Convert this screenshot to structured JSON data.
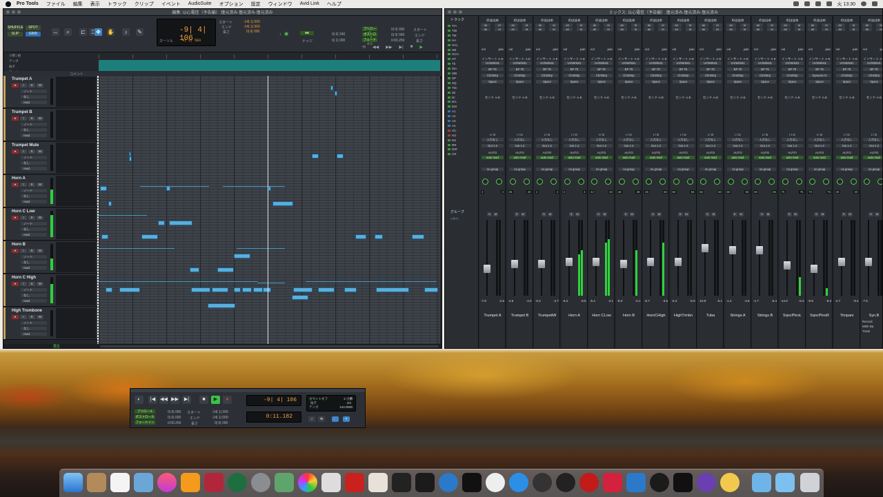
{
  "menubar": {
    "app": "Pro Tools",
    "items": [
      "ファイル",
      "編集",
      "表示",
      "トラック",
      "クリップ",
      "イベント",
      "AudioSuite",
      "オプション",
      "設定",
      "ウィンドウ",
      "Avid Link",
      "ヘルプ"
    ],
    "clock": "火 13:30"
  },
  "edit_window": {
    "title": "編集: 以心電信（予告編）.復元済み.復元済み.復元済み",
    "modes": [
      "SHUFFLE",
      "SPOT",
      "SLIP",
      "GRID"
    ],
    "counter": {
      "main": "-9| 4| 106",
      "label": "カーソル",
      "sub": "4| 3| 583",
      "start_label": "スタート",
      "end_label": "エンド",
      "length_label": "長さ",
      "start": "-14| 1| 000",
      "end": "-14| 1| 000",
      "length": "0| 0| 000"
    },
    "nudge": {
      "label": "ナッジ",
      "value": "0| 0| 240",
      "grid": "0| 1| 000"
    },
    "preroll": {
      "pre": "プリロール",
      "post": "ポストロール",
      "fade": "フェードイン",
      "pre_v": "0| 0| 000",
      "post_v": "0| 0| 000",
      "fade_v": "0:00.250"
    },
    "rulers": [
      "小節 | 拍",
      "テンポ",
      "拍子",
      "マーカー"
    ],
    "comment_label": "コメント",
    "tracks": [
      {
        "name": "Trumpet A",
        "meter": 0
      },
      {
        "name": "Trumpet B",
        "meter": 0
      },
      {
        "name": "Trumpet Mute",
        "meter": 0
      },
      {
        "name": "Horn A",
        "meter": 0.55
      },
      {
        "name": "Horn C Low",
        "meter": 0.85
      },
      {
        "name": "Horn B",
        "meter": 0.45
      },
      {
        "name": "Horn C High",
        "meter": 0.75
      },
      {
        "name": "High Trombone",
        "meter": 0
      }
    ],
    "track_sub": [
      "ノート",
      "なし",
      "read"
    ],
    "status": "再生"
  },
  "mix_window": {
    "title": "ミックス: 以心電信（予告編）.復元済み.復元済み.復元済み",
    "track_panel_header": "トラック",
    "track_items": [
      "TrA",
      "TrB",
      "TM",
      "HA",
      "HCL",
      "HB",
      "HCH",
      "HT",
      "Tb",
      "StA",
      "StB",
      "SP",
      "SQ",
      "Tim",
      "Sti",
      "Dr",
      "DrL",
      "DM",
      "A1",
      "A2",
      "A3",
      "A4",
      "Clc",
      "Hd",
      "M1",
      "RR",
      "DIR",
      "CR"
    ],
    "group_header": "グループ",
    "group_item": "<すべ",
    "strips": [
      {
        "name": "Trumpet A",
        "ins": [
          "インサート A-E",
          "UVIWrkst1",
          "BF-76",
          "ChnlStrp",
          "Space"
        ],
        "vol": [
          "-7.8",
          "-2.6"
        ],
        "pan": [
          "3",
          "3"
        ],
        "meter": [
          0,
          0
        ],
        "fader": 0.35
      },
      {
        "name": "Trumpet B",
        "ins": [
          "インサート A-E",
          "UVIWrkst1",
          "BF-76",
          "ChnlStrp",
          "Space"
        ],
        "vol": [
          "-4.6",
          "-4.0"
        ],
        "pan": [
          "35",
          "40"
        ],
        "meter": [
          0,
          0
        ],
        "fader": 0.42
      },
      {
        "name": "TrumpetMt",
        "ins": [
          "インサート A-E",
          "UVIWrkst1",
          "BF-76",
          "ChnlStrp",
          "Space"
        ],
        "vol": [
          "-0.2",
          "-2.7"
        ],
        "pan": [
          "4",
          "4"
        ],
        "meter": [
          0,
          0
        ],
        "fader": 0.42
      },
      {
        "name": "Horn A",
        "ins": [
          "インサート A-E",
          "UVIWrkst1",
          "BF-76",
          "ChnlStrp",
          "Space"
        ],
        "vol": [
          "-6.2",
          "-8.5"
        ],
        "pan": [
          "3",
          "3"
        ],
        "meter": [
          0.55,
          0.6
        ],
        "fader": 0.45
      },
      {
        "name": "Horn CLow",
        "ins": [
          "インサート A-E",
          "UVIWrkst1",
          "BF-76",
          "ChnlStrp",
          "Space"
        ],
        "vol": [
          "-5.4",
          "-4.1"
        ],
        "pan": [
          "42",
          "33"
        ],
        "meter": [
          0.7,
          0.75
        ],
        "fader": 0.45
      },
      {
        "name": "Horn B",
        "ins": [
          "インサート A-E",
          "UVIWrkst1",
          "BF-76",
          "ChnlStrp",
          "Space"
        ],
        "vol": [
          "-8.3",
          "-0.1"
        ],
        "pan": [
          "48",
          "48"
        ],
        "meter": [
          0,
          0.6
        ],
        "fader": 0.42
      },
      {
        "name": "HornCHigh",
        "ins": [
          "インサート A-E",
          "UVIWrkst1",
          "BF-76",
          "ChnlStrp",
          "Space"
        ],
        "vol": [
          "-5.7",
          "-3.5"
        ],
        "pan": [
          "45",
          "50"
        ],
        "meter": [
          0,
          0.7
        ],
        "fader": 0.45
      },
      {
        "name": "HighTrmbn",
        "ins": [
          "インサート A-E",
          "UVIWrkst1",
          "BF-76",
          "ChnlStrp",
          "Space"
        ],
        "vol": [
          "-5.4",
          "-5.0"
        ],
        "pan": [
          "50",
          "55"
        ],
        "meter": [
          0,
          0
        ],
        "fader": 0.45
      },
      {
        "name": "Tuba",
        "ins": [
          "インサート A-E",
          "UVIWrkst1",
          "BF-76",
          "ChnlStrp",
          "Space"
        ],
        "vol": [
          "-10.8",
          "-6.1"
        ],
        "pan": [
          "65",
          "60"
        ],
        "meter": [
          0,
          0
        ],
        "fader": 0.65
      },
      {
        "name": "Strings A",
        "ins": [
          "インサート A-E",
          "UVIWrkst1",
          "BF-76",
          "ChnlStrp",
          "Space"
        ],
        "vol": [
          "-1.4",
          "-4.6"
        ],
        "pan": [
          "60",
          "65"
        ],
        "meter": [
          0,
          0
        ],
        "fader": 0.62
      },
      {
        "name": "Strings B",
        "ins": [
          "インサート A-E",
          "UVIWrkst1",
          "BF-76",
          "ChnlStrp",
          "Space"
        ],
        "vol": [
          "-1.7",
          "-5.4"
        ],
        "pan": [
          "60",
          "65"
        ],
        "meter": [
          0,
          0
        ],
        "fader": 0.62
      },
      {
        "name": "SqncPhrsL",
        "ins": [
          "インサート A-E",
          "UVIWrkst1",
          "BF-76",
          "ChnlStrp",
          "Space"
        ],
        "vol": [
          "-14.0",
          "-6.3"
        ],
        "pan": [
          "75",
          "75"
        ],
        "meter": [
          0,
          0.25
        ],
        "fader": 0.4
      },
      {
        "name": "SqncPhrsR",
        "ins": [
          "インサート A-E",
          "UVIWrkst1",
          "BF-76",
          "Dynamic D",
          "Space"
        ],
        "vol": [
          "-9.9",
          "-8.3"
        ],
        "pan": [
          "70",
          "75"
        ],
        "meter": [
          0,
          0.1
        ],
        "fader": 0.35
      },
      {
        "name": "Timpani",
        "ins": [
          "インサート A-E",
          "UVIWrkst1",
          "BF-76",
          "ChnlStrp",
          "Space"
        ],
        "vol": [
          "-2.7",
          "-8.4"
        ],
        "pan": [
          "30",
          "30"
        ],
        "meter": [
          0,
          0
        ],
        "fader": 0.45
      },
      {
        "name": "Syn.B",
        "ins": [
          "インサート A-E",
          "UVIWrkst1",
          "BF-76",
          "ChnlStrp",
          "Space"
        ],
        "vol": [
          "-7.5",
          ""
        ],
        "pan": [
          "",
          ""
        ],
        "meter": [
          0,
          0
        ],
        "fader": 0.45
      }
    ],
    "strip_labels": {
      "header": "のははめ",
      "all": "All",
      "m": "M",
      "vol": "vol",
      "pan": "pan",
      "sends": "センド A-E",
      "io": "I / O",
      "input": "入力なし",
      "output": "Out 1-2",
      "auto": "AUTO",
      "read": "auto read",
      "group": "no group"
    },
    "last_strip_extra": [
      "Record",
      "MIDI Ba",
      "Track"
    ]
  },
  "transport": {
    "counter_main": "-9| 4| 106",
    "counter_sub": "0:11.182",
    "preroll_label": "プリロール",
    "postroll_label": "ポストロール",
    "fadein_label": "フェードイン",
    "preroll": "0| 0| 000",
    "postroll": "0| 0| 000",
    "fadein": "0:00.250",
    "start_label": "スタート",
    "end_label": "エンド",
    "length_label": "長さ",
    "start": "-14| 1| 000",
    "end": "-14| 1| 000",
    "length": "0| 0| 000",
    "meter_label": "拍子",
    "tempo_label": "テンポ",
    "count": "カウントオフ",
    "meter_value": "4/4",
    "tempo_value": "124.0000",
    "bars": "2 小節"
  },
  "colors": {
    "accent": "#3e84c9",
    "notes": "#5aaedc",
    "ruler": "#1e7e7c",
    "counter": "#f3a13b",
    "meter": "#2fcf3c"
  }
}
